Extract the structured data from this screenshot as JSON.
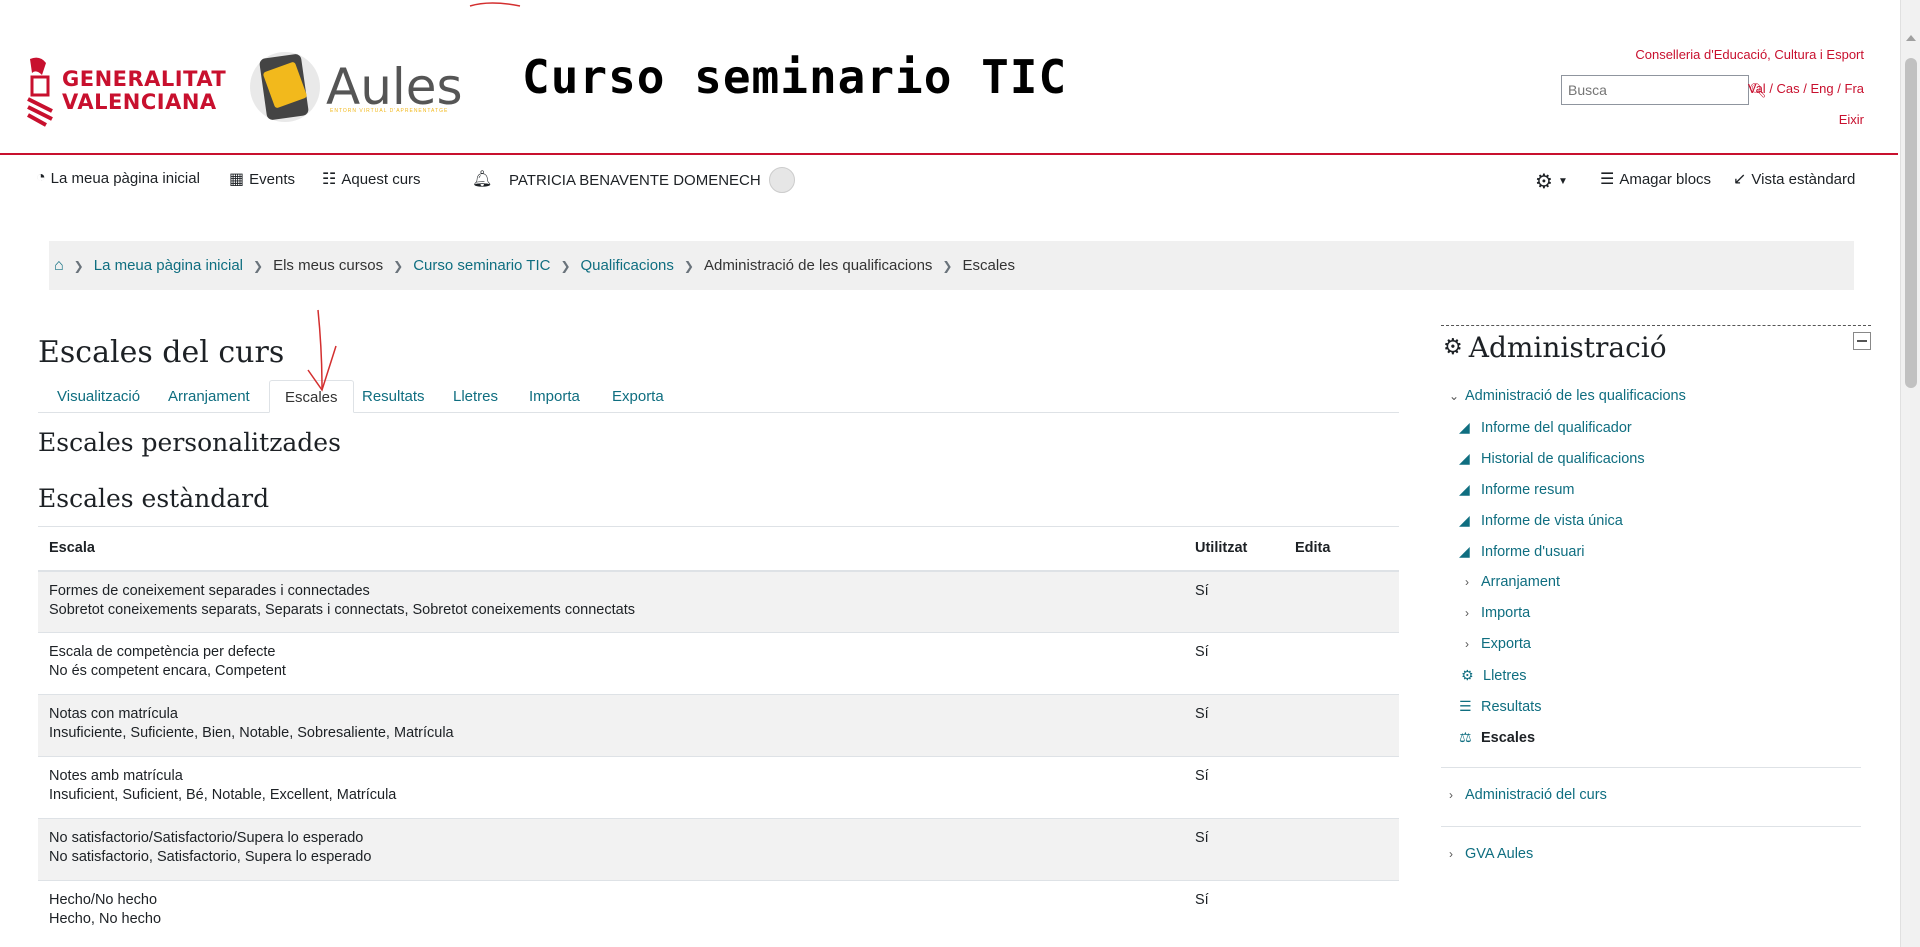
{
  "header": {
    "gv_logo_lines": [
      "GENERALITAT",
      "VALENCIANA"
    ],
    "aules_word": "Aules",
    "aules_sub": "ENTORN VIRTUAL D'APRENENTATGE",
    "course_title": "Curso seminario TIC",
    "conselleria": "Conselleria d'Educació, Cultura i Esport",
    "search_placeholder": "Busca",
    "langs": [
      "Val",
      "Cas",
      "Eng",
      "Fra"
    ],
    "lang_sep": " / ",
    "exit": "Eixir"
  },
  "navbar": {
    "home": "La meua pàgina inicial",
    "events": "Events",
    "course": "Aquest curs",
    "user": "PATRICIA BENAVENTE DOMENECH",
    "hide_blocks": "Amagar blocs",
    "standard_view": "Vista estàndard"
  },
  "breadcrumb": {
    "items": [
      "La meua pàgina inicial",
      "Els meus cursos",
      "Curso seminario TIC",
      "Qualificacions",
      "Administració de les qualificacions",
      "Escales"
    ]
  },
  "main": {
    "title": "Escales del curs",
    "tabs": [
      "Visualització",
      "Arranjament",
      "Escales",
      "Resultats",
      "Lletres",
      "Importa",
      "Exporta"
    ],
    "active_tab": "Escales",
    "custom_heading": "Escales personalitzades",
    "standard_heading": "Escales estàndard",
    "table": {
      "headers": [
        "Escala",
        "Utilitzat",
        "Edita"
      ],
      "rows": [
        {
          "name": "Formes de coneixement separades i connectades",
          "items": "Sobretot coneixements separats, Separats i connectats, Sobretot coneixements connectats",
          "used": "Sí"
        },
        {
          "name": "Escala de competència per defecte",
          "items": "No és competent encara, Competent",
          "used": "Sí"
        },
        {
          "name": "Notas con matrícula",
          "items": "Insuficiente, Suficiente, Bien, Notable, Sobresaliente, Matrícula",
          "used": "Sí"
        },
        {
          "name": "Notes amb matrícula",
          "items": "Insuficient, Suficient, Bé, Notable, Excellent, Matrícula",
          "used": "Sí"
        },
        {
          "name": "No satisfactorio/Satisfactorio/Supera lo esperado",
          "items": "No satisfactorio, Satisfactorio, Supera lo esperado",
          "used": "Sí"
        },
        {
          "name": "Hecho/No hecho",
          "items": "Hecho, No hecho",
          "used": "Sí"
        }
      ]
    }
  },
  "sidebar": {
    "title": "Administració",
    "section": "Administració de les qualificacions",
    "items": [
      {
        "label": "Informe del qualificador",
        "icon": "chart-icon"
      },
      {
        "label": "Historial de qualificacions",
        "icon": "chart-icon"
      },
      {
        "label": "Informe resum",
        "icon": "chart-icon"
      },
      {
        "label": "Informe de vista única",
        "icon": "chart-icon"
      },
      {
        "label": "Informe d'usuari",
        "icon": "chart-icon"
      },
      {
        "label": "Arranjament",
        "icon": "chevron-right-icon"
      },
      {
        "label": "Importa",
        "icon": "chevron-right-icon"
      },
      {
        "label": "Exporta",
        "icon": "chevron-right-icon"
      },
      {
        "label": "Lletres",
        "icon": "gear-icon"
      },
      {
        "label": "Resultats",
        "icon": "list-icon"
      },
      {
        "label": "Escales",
        "icon": "balance-icon"
      }
    ],
    "course_admin": "Administració del curs",
    "gva_aules": "GVA Aules"
  }
}
